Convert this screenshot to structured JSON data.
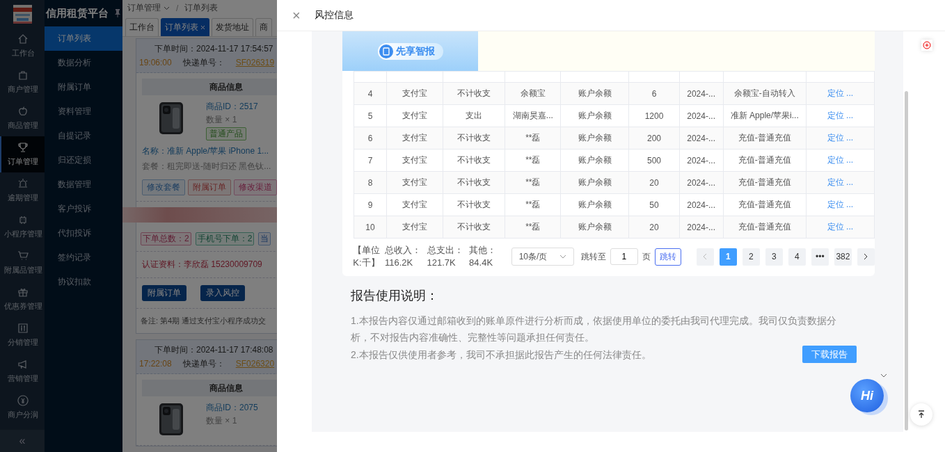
{
  "app": {
    "title": "信用租赁平台"
  },
  "nav": [
    {
      "label": "工作台",
      "selected": false
    },
    {
      "label": "商户管理",
      "selected": false
    },
    {
      "label": "商品管理",
      "selected": false
    },
    {
      "label": "订单管理",
      "selected": true
    },
    {
      "label": "逾期管理",
      "selected": false
    },
    {
      "label": "小程序管理",
      "selected": false
    },
    {
      "label": "附属品管理",
      "selected": false
    },
    {
      "label": "优惠券管理",
      "selected": false
    },
    {
      "label": "分销管理",
      "selected": false
    },
    {
      "label": "营销管理",
      "selected": false
    },
    {
      "label": "商户分润",
      "selected": false
    }
  ],
  "collapse": "«",
  "submenu": [
    {
      "label": "订单列表",
      "selected": true
    },
    {
      "label": "数据分析",
      "selected": false
    },
    {
      "label": "附属订单",
      "selected": false
    },
    {
      "label": "资料管理",
      "selected": false
    },
    {
      "label": "自提记录",
      "selected": false
    },
    {
      "label": "归还定损",
      "selected": false
    },
    {
      "label": "数据管理",
      "selected": false
    },
    {
      "label": "客户投诉",
      "selected": false
    },
    {
      "label": "代扣投诉",
      "selected": false
    },
    {
      "label": "签约记录",
      "selected": false
    },
    {
      "label": "协议扣款",
      "selected": false
    }
  ],
  "breadcrumb": [
    "订单管理",
    "订单列表"
  ],
  "breadcrumb_separator": "/",
  "tabs": [
    {
      "label": "工作台",
      "selected": false,
      "closable": false
    },
    {
      "label": "订单列表",
      "selected": true,
      "closable": true
    },
    {
      "label": "发货地址",
      "selected": false,
      "closable": false
    },
    {
      "label": "商",
      "selected": false,
      "closable": false
    }
  ],
  "orders": [
    {
      "time_label": "下单时间：",
      "time": "2024-11-17 17:54:57",
      "time2": "19:06:00",
      "express_label": "快递单号：",
      "express": "SF026319",
      "section": "商品信息",
      "product_id": "商品ID：2517",
      "qty": "数量 × 1",
      "tag": "普通产品",
      "name": "名称：准新 Apple/苹果 iPhone 1...",
      "plan": "套餐：租完即送-随时归还 黑色钛...",
      "actions": [
        "修改套餐",
        "附属订单",
        "修改渠道"
      ],
      "stats": [
        "下单总数：2",
        "手机号下单：2",
        "当"
      ],
      "cert": "认证资料：李欣磊  15230009709",
      "buttons": [
        "附属订单",
        "录入风控"
      ],
      "note": "备注: 第4期 通过支付宝小程序成功交"
    },
    {
      "time_label": "下单时间：",
      "time": "2024-11-17 17:48:08",
      "time2": "17:22:08",
      "express_label": "快递单号：",
      "express": "SF026320",
      "section": "商品信息",
      "product_id": "商品ID：2075",
      "qty": "数量 × 1"
    }
  ],
  "drawer": {
    "title": "风控信息",
    "close": "×",
    "brand": "先享智报",
    "rows": [
      {
        "cells": [
          "4",
          "支付宝",
          "不计收支",
          "余额宝",
          "账户余额",
          "6",
          "2024-...",
          "余额宝-自动转入"
        ],
        "link": "定位 ..."
      },
      {
        "cells": [
          "5",
          "支付宝",
          "支出",
          "湖南昊嘉...",
          "账户余额",
          "1200",
          "2024-...",
          "准新 Apple/苹果i..."
        ],
        "link": "定位 ..."
      },
      {
        "cells": [
          "6",
          "支付宝",
          "不计收支",
          "**磊",
          "账户余额",
          "200",
          "2024-...",
          "充值-普通充值"
        ],
        "link": "定位 ..."
      },
      {
        "cells": [
          "7",
          "支付宝",
          "不计收支",
          "**磊",
          "账户余额",
          "500",
          "2024-...",
          "充值-普通充值"
        ],
        "link": "定位 ..."
      },
      {
        "cells": [
          "8",
          "支付宝",
          "不计收支",
          "**磊",
          "账户余额",
          "20",
          "2024-...",
          "充值-普通充值"
        ],
        "link": "定位 ..."
      },
      {
        "cells": [
          "9",
          "支付宝",
          "不计收支",
          "**磊",
          "账户余额",
          "50",
          "2024-...",
          "充值-普通充值"
        ],
        "link": "定位 ..."
      },
      {
        "cells": [
          "10",
          "支付宝",
          "不计收支",
          "**磊",
          "账户余额",
          "20",
          "2024-...",
          "充值-普通充值"
        ],
        "link": "定位 ..."
      }
    ],
    "unit": "【单位K:千】",
    "totals": [
      {
        "label": "总收入：",
        "value": "116.2K"
      },
      {
        "label": "总支出：",
        "value": "121.7K"
      },
      {
        "label": "其他：",
        "value": "84.4K"
      }
    ],
    "page_size": "10条/页",
    "jump_label": "跳转至",
    "jump_value": "1",
    "page_unit": "页",
    "jump_button": "跳转",
    "pages": [
      {
        "label": "1",
        "selected": true
      },
      {
        "label": "2",
        "selected": false
      },
      {
        "label": "3",
        "selected": false
      },
      {
        "label": "4",
        "selected": false
      },
      {
        "label": "•••",
        "selected": false
      },
      {
        "label": "382",
        "selected": false
      }
    ],
    "notes_title": "报告使用说明：",
    "notes": [
      "1.本报告内容仅通过邮箱收到的账单原件进行分析而成，依据使用单位的委托由我司代理完成。我司仅负责数据分析，不对报告内容准确性、完整性等问题承担任何责任。",
      "2.本报告仅供使用者参考，我司不承担据此报告产生的任何法律责任。"
    ],
    "download": "下载报告",
    "chat": "Hi"
  }
}
